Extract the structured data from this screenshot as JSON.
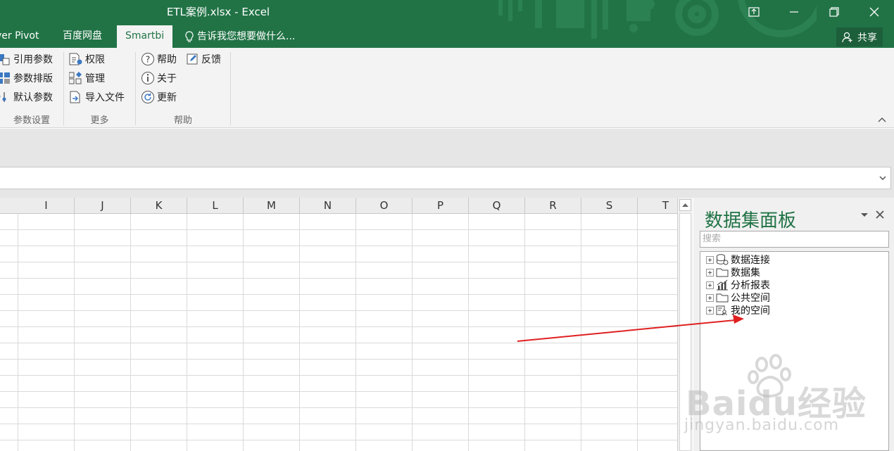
{
  "window": {
    "title": "ETL案例.xlsx - Excel"
  },
  "tabs": [
    {
      "label": "ver Pivot"
    },
    {
      "label": "百度网盘"
    },
    {
      "label": "Smartbi"
    }
  ],
  "tell_me": "告诉我您想要做什么...",
  "share_label": "共享",
  "ribbon": {
    "param_group": {
      "items": [
        "引用参数",
        "参数排版",
        "默认参数"
      ],
      "label": "参数设置"
    },
    "more_group": {
      "items": [
        "权限",
        "管理",
        "导入文件"
      ],
      "label": "更多"
    },
    "help_group": {
      "items": [
        "帮助",
        "反馈",
        "关于",
        "更新"
      ],
      "label": "帮助"
    }
  },
  "grid": {
    "columns": [
      "I",
      "J",
      "K",
      "L",
      "M",
      "N",
      "O",
      "P",
      "Q",
      "R",
      "S",
      "T"
    ]
  },
  "panel": {
    "title": "数据集面板",
    "search_placeholder": "搜索",
    "tree": [
      "数据连接",
      "数据集",
      "分析报表",
      "公共空间",
      "我的空间"
    ]
  },
  "watermark": {
    "brand": "Baidu经验",
    "sub": "jingyan.baidu.com"
  },
  "colors": {
    "excel_green": "#217346",
    "annotation_red": "#e02020"
  }
}
